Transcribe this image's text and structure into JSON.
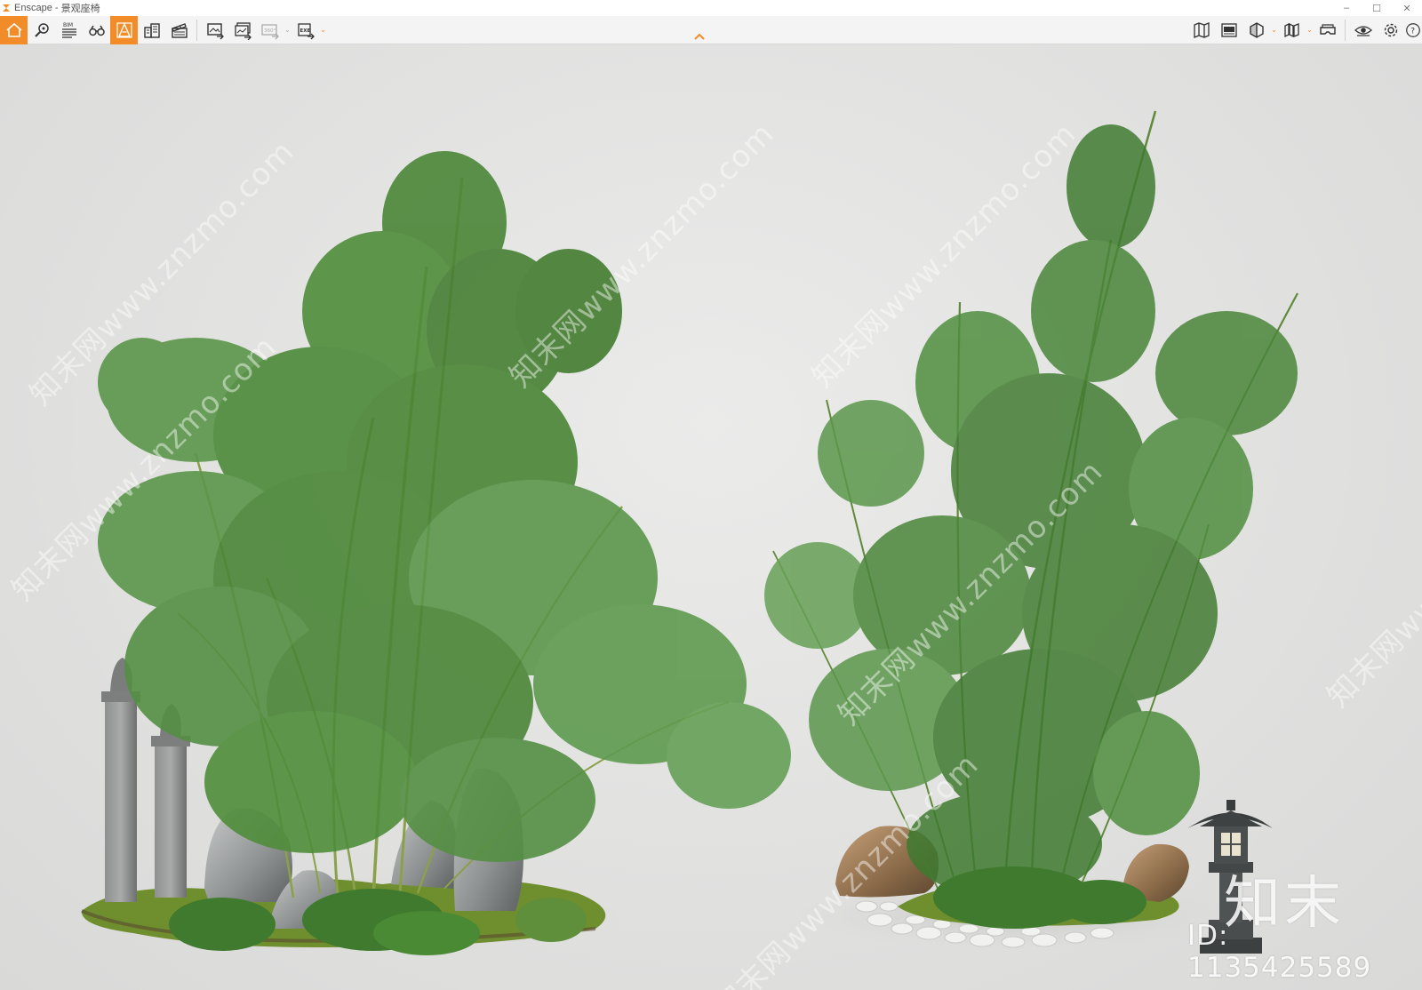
{
  "window": {
    "app_name": "Enscape",
    "separator": " - ",
    "document_name": "景观座椅",
    "controls": {
      "minimize": "–",
      "maximize": "☐",
      "close": "✕"
    }
  },
  "toolbar": {
    "accent_color": "#f28c28",
    "left_buttons": [
      {
        "name": "home-icon",
        "active": true
      },
      {
        "name": "asset-library-icon"
      },
      {
        "name": "bim-icon",
        "label": "BIM"
      },
      {
        "name": "binoculars-icon"
      },
      {
        "name": "orthographic-icon",
        "active": true
      },
      {
        "name": "buildings-icon"
      },
      {
        "name": "clapperboard-icon"
      }
    ],
    "export_buttons": [
      {
        "name": "screenshot-export-icon"
      },
      {
        "name": "batch-render-icon"
      },
      {
        "name": "panorama-export-icon",
        "label": "360°",
        "disabled": true
      },
      {
        "name": "exe-export-icon",
        "label": "EXE"
      }
    ],
    "right_buttons": [
      {
        "name": "map-icon"
      },
      {
        "name": "views-icon"
      },
      {
        "name": "section-icon"
      },
      {
        "name": "atlas-icon"
      },
      {
        "name": "vr-headset-icon"
      },
      {
        "name": "visibility-icon"
      },
      {
        "name": "settings-gear-icon"
      },
      {
        "name": "help-icon"
      }
    ]
  },
  "viewport": {
    "watermark_text": "知末网www.znzmo.com",
    "brand_mark": "知末",
    "brand_id": "ID: 1135425589"
  }
}
